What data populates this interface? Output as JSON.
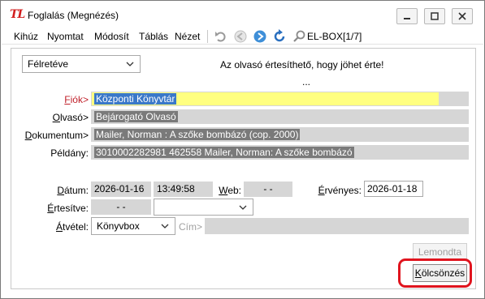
{
  "window": {
    "logo_text": "TL",
    "title": "Foglalás (Megnézés)"
  },
  "menu": {
    "items": [
      "Kihúz",
      "Nyomtat",
      "Módosít",
      "Táblás",
      "Nézet"
    ]
  },
  "toolbar": {
    "search_label": "EL-BOX[1/7]",
    "icons": [
      "undo-icon",
      "back-icon",
      "forward-icon",
      "refresh-icon",
      "search-icon"
    ]
  },
  "status_select": {
    "value": "Félretéve"
  },
  "message": {
    "line1": "Az olvasó értesíthető, hogy jöhet érte!",
    "line2": "..."
  },
  "form": {
    "fiok_label": "Fiók>",
    "fiok_value": "Központi Könyvtár",
    "olvaso_label": "Olvasó>",
    "olvaso_value": "Bejárogató Olvasó",
    "dokumentum_label": "Dokumentum>",
    "dokumentum_value": "Mailer, Norman : A szőke bombázó (cop. 2000)",
    "peldany_label": "Példány:",
    "peldany_value": "3010002282981 462558 Mailer, Norman: A szőke bombázó",
    "datum_label": "Dátum:",
    "datum_value": "2026-01-16",
    "time_value": "13:49:58",
    "web_label": "Web:",
    "web_value": "-  -",
    "ervenyes_label": "Érvényes:",
    "ervenyes_value": "2026-01-18",
    "ertesitve_label": "Értesítve:",
    "ertesitve_value": "-  -",
    "ertesitve_select_value": "",
    "atvetel_label": "Átvétel:",
    "atvetel_value": "Könyvbox",
    "cim_label": "Cím>",
    "cim_value": ""
  },
  "buttons": {
    "lemondta": "Lemondta",
    "kolcsonzes": "Kölcsönzés"
  },
  "colors": {
    "fiok_highlight": "#ffff80",
    "accent_red": "#e0141e",
    "logo_red": "#d21f1f"
  }
}
